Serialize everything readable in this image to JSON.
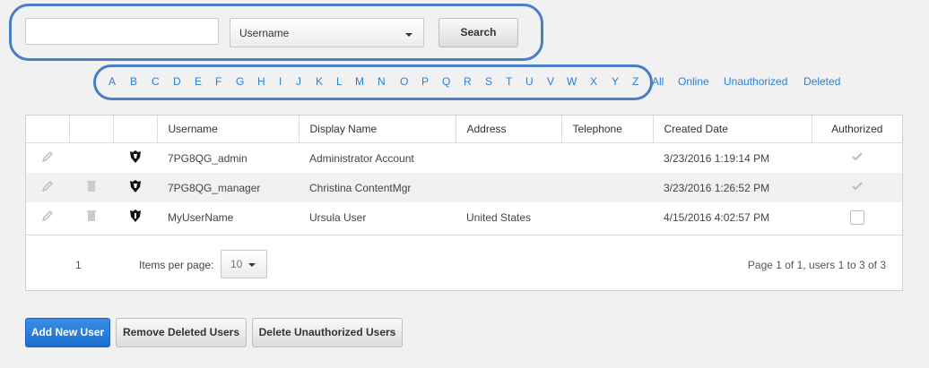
{
  "search": {
    "input_value": "",
    "filter_selected": "Username",
    "button_label": "Search"
  },
  "letters": [
    "A",
    "B",
    "C",
    "D",
    "E",
    "F",
    "G",
    "H",
    "I",
    "J",
    "K",
    "L",
    "M",
    "N",
    "O",
    "P",
    "Q",
    "R",
    "S",
    "T",
    "U",
    "V",
    "W",
    "X",
    "Y",
    "Z"
  ],
  "filters": [
    "All",
    "Online",
    "Unauthorized",
    "Deleted"
  ],
  "table": {
    "columns": [
      "",
      "",
      "",
      "Username",
      "Display Name",
      "Address",
      "Telephone",
      "Created Date",
      "Authorized"
    ],
    "rows": [
      {
        "username": "7PG8QG_admin",
        "display_name": "Administrator Account",
        "address": "",
        "telephone": "",
        "created": "3/23/2016 1:19:14 PM",
        "authorized": true,
        "deletable": false
      },
      {
        "username": "7PG8QG_manager",
        "display_name": "Christina ContentMgr",
        "address": "",
        "telephone": "",
        "created": "3/23/2016 1:26:52 PM",
        "authorized": true,
        "deletable": true
      },
      {
        "username": "MyUserName",
        "display_name": "Ursula User",
        "address": "United States",
        "telephone": "",
        "created": "4/15/2016 4:02:57 PM",
        "authorized": false,
        "deletable": true
      }
    ]
  },
  "pager": {
    "current_page": "1",
    "items_per_page_label": "Items per page:",
    "items_per_page": "10",
    "info": "Page 1 of 1, users 1 to 3 of 3"
  },
  "actions": {
    "add": "Add New User",
    "remove_deleted": "Remove Deleted Users",
    "delete_unauthorized": "Delete Unauthorized Users"
  },
  "colors": {
    "link": "#2a7ed8",
    "highlight_outline": "#4a7ec4",
    "primary_button": "#1c6fce"
  }
}
